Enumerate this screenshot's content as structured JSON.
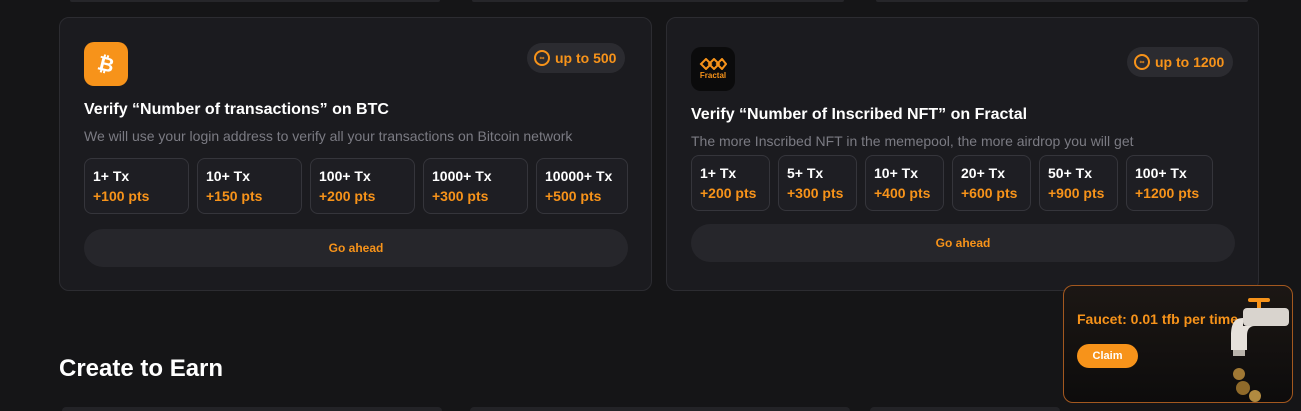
{
  "cards": [
    {
      "logo_icon": "bitcoin-icon",
      "badge": "up to 500",
      "title": "Verify “Number of transactions” on BTC",
      "description": "We will use your login address to verify all your transactions on Bitcoin network",
      "tiers": [
        {
          "label": "1+ Tx",
          "pts": "+100 pts"
        },
        {
          "label": "10+ Tx",
          "pts": "+150 pts"
        },
        {
          "label": "100+ Tx",
          "pts": "+200 pts"
        },
        {
          "label": "1000+ Tx",
          "pts": "+300 pts"
        },
        {
          "label": "10000+ Tx",
          "pts": "+500 pts"
        }
      ],
      "button": "Go ahead"
    },
    {
      "logo_icon": "fractal-logo-icon",
      "logo_text": "Fractal",
      "badge": "up to 1200",
      "title": "Verify “Number of Inscribed NFT” on Fractal",
      "description": "The more Inscribed NFT in the memepool, the more airdrop you will get",
      "tiers": [
        {
          "label": "1+ Tx",
          "pts": "+200 pts"
        },
        {
          "label": "5+ Tx",
          "pts": "+300 pts"
        },
        {
          "label": "10+ Tx",
          "pts": "+400 pts"
        },
        {
          "label": "20+ Tx",
          "pts": "+600 pts"
        },
        {
          "label": "50+ Tx",
          "pts": "+900 pts"
        },
        {
          "label": "100+ Tx",
          "pts": "+1200 pts"
        }
      ],
      "button": "Go ahead"
    }
  ],
  "section_title": "Create to Earn",
  "faucet": {
    "text": "Faucet: 0.01 tfb per time",
    "claim": "Claim",
    "icon": "faucet-tap-icon"
  },
  "colors": {
    "accent": "#f7931a",
    "background": "#151517",
    "card": "#1b1b1f"
  }
}
